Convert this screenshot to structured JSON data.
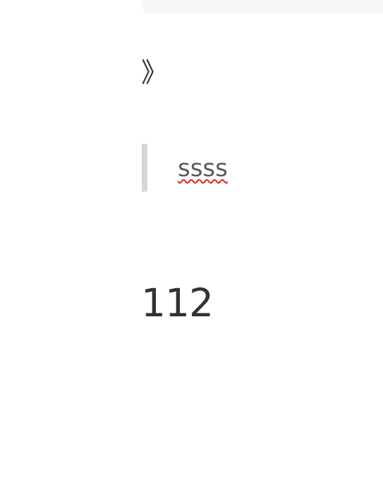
{
  "editor": {
    "chevron_glyph": "》",
    "blockquote_text": "ssss",
    "paragraph_text": "112"
  }
}
